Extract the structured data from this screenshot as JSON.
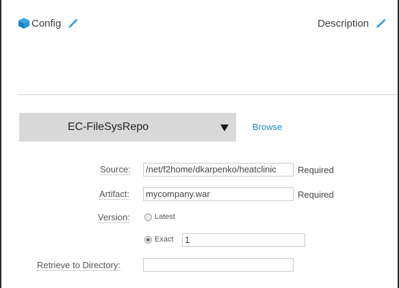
{
  "header": {
    "title": "Config",
    "description_label": "Description",
    "icon": "cube-icon",
    "edit_icon": "pencil-icon"
  },
  "repository": {
    "selected": "EC-FileSysRepo",
    "dropdown_icon": "caret-down-icon",
    "browse_label": "Browse"
  },
  "form": {
    "source": {
      "label": "Source:",
      "value": "/net/f2home/dkarpenko/heatclinic",
      "required_label": "Required"
    },
    "artifact": {
      "label": "Artifact:",
      "value": "mycompany.war",
      "required_label": "Required"
    },
    "version": {
      "label": "Version:",
      "options": [
        {
          "label": "Latest",
          "selected": false
        },
        {
          "label": "Exact",
          "selected": true
        }
      ],
      "exact_value": "1"
    },
    "retrieve_dir": {
      "label": "Retrieve to Directory:",
      "value": ""
    }
  },
  "colors": {
    "accent": "#1f88c9",
    "select_bg": "#d9d9d9",
    "divider": "#cfcfcf"
  }
}
